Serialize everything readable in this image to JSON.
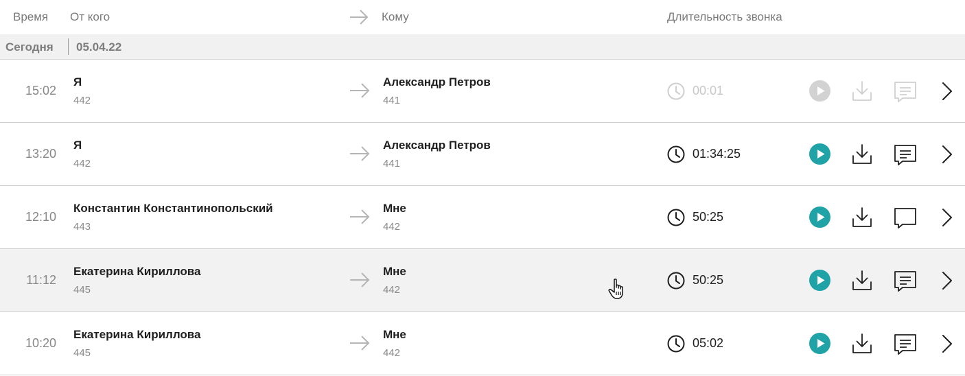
{
  "header": {
    "col_time": "Время",
    "col_from": "От кого",
    "col_to": "Кому",
    "col_duration": "Длительность звонка"
  },
  "group": {
    "label": "Сегодня",
    "date": "05.04.22"
  },
  "colors": {
    "accent_teal": "#1fa3a6",
    "disabled_gray": "#cfcfcf",
    "hover_row_bg": "#f2f2f2",
    "group_bg": "#f1f1f1"
  },
  "calls": [
    {
      "time": "15:02",
      "from_name": "Я",
      "from_ext": "442",
      "to_name": "Александр Петров",
      "to_ext": "441",
      "duration": "00:01",
      "disabled": true,
      "comment_icon": "message-text-icon"
    },
    {
      "time": "13:20",
      "from_name": "Я",
      "from_ext": "442",
      "to_name": "Александр Петров",
      "to_ext": "441",
      "duration": "01:34:25",
      "disabled": false,
      "comment_icon": "message-text-icon"
    },
    {
      "time": "12:10",
      "from_name": "Константин Константинопольский",
      "from_ext": "443",
      "to_name": "Мне",
      "to_ext": "442",
      "duration": "50:25",
      "disabled": false,
      "comment_icon": "message-empty-icon"
    },
    {
      "time": "11:12",
      "from_name": "Екатерина Кириллова",
      "from_ext": "445",
      "to_name": "Мне",
      "to_ext": "442",
      "duration": "50:25",
      "disabled": false,
      "hover": true,
      "comment_icon": "message-text-icon"
    },
    {
      "time": "10:20",
      "from_name": "Екатерина Кириллова",
      "from_ext": "445",
      "to_name": "Мне",
      "to_ext": "442",
      "duration": "05:02",
      "disabled": false,
      "comment_icon": "message-text-icon"
    }
  ]
}
